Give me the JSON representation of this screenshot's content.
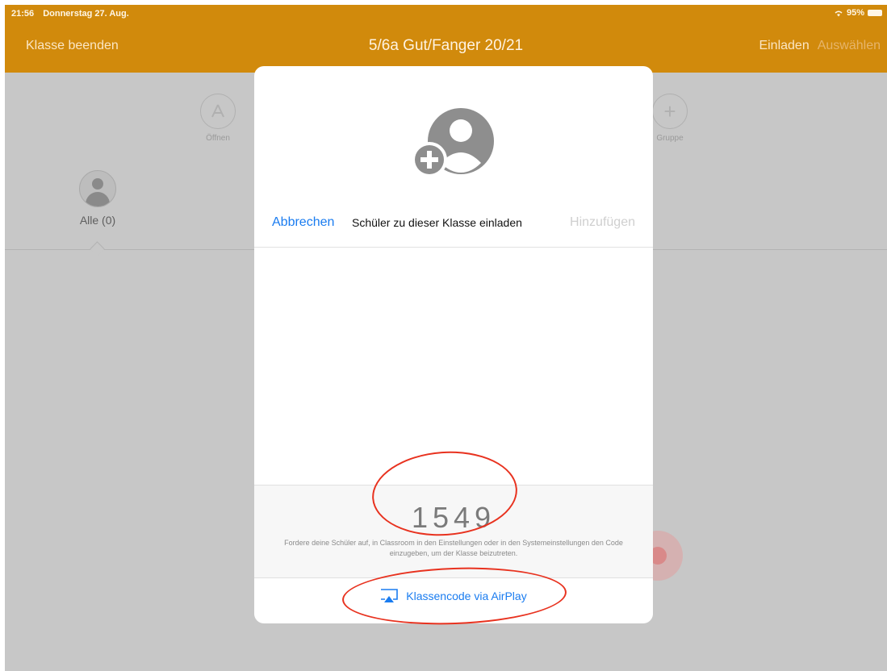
{
  "status_bar": {
    "time": "21:56",
    "date": "Donnerstag 27. Aug.",
    "battery": "95%"
  },
  "nav": {
    "left": "Klasse beenden",
    "title": "5/6a Gut/Fanger 20/21",
    "invite": "Einladen",
    "select": "Auswählen"
  },
  "toolbar": {
    "open_label": "Öffnen",
    "group_label": "Gruppe"
  },
  "filter": {
    "all_label": "Alle (0)"
  },
  "modal": {
    "cancel": "Abbrechen",
    "title": "Schüler zu dieser Klasse einladen",
    "add": "Hinzufügen",
    "code": "1549",
    "hint": "Fordere deine Schüler auf, in Classroom in den Einstellungen oder in den Systemeinstellungen den Code einzugeben, um der Klasse beizutreten.",
    "airplay": "Klassencode via AirPlay"
  },
  "colors": {
    "accent": "#d18a0c",
    "link": "#1a7cf0",
    "annotation": "#e8321f"
  },
  "icons": [
    "wifi-icon",
    "battery-icon",
    "app-store-icon",
    "plus-icon",
    "avatar-icon",
    "add-student-icon",
    "airplay-icon"
  ]
}
